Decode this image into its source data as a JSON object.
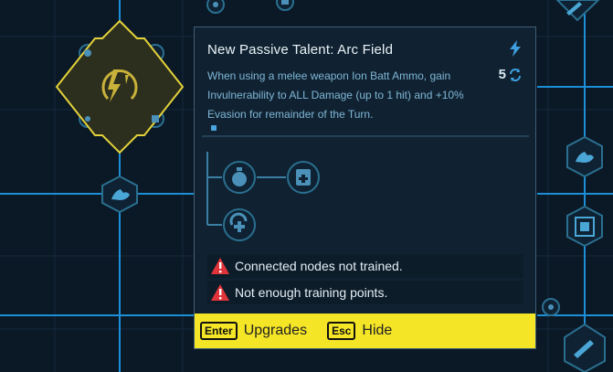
{
  "tooltip": {
    "title": "New Passive Talent: Arc Field",
    "description": "When using a melee weapon Ion Batt Ammo, gain Invulnerability to ALL Damage (up to 1 hit) and +10% Evasion for remainder of the Turn.",
    "cost": "5",
    "warnings": [
      "Connected nodes not trained.",
      "Not enough training points."
    ]
  },
  "footer": {
    "upgrades_key": "Enter",
    "upgrades_label": "Upgrades",
    "hide_key": "Esc",
    "hide_label": "Hide"
  },
  "colors": {
    "accent_yellow": "#f4e526",
    "warning_red": "#e0343a",
    "grid_blue": "#1c8fd6",
    "node_teal": "#2a6f8f"
  },
  "icons": {
    "selected_node": "arc-field-talent-icon",
    "tree_nodes": [
      "stopwatch-icon",
      "medkit-icon",
      "heal-cycle-icon"
    ],
    "side_nodes": [
      "muscle-arm-icon",
      "chip-icon",
      "knife-icon"
    ]
  }
}
